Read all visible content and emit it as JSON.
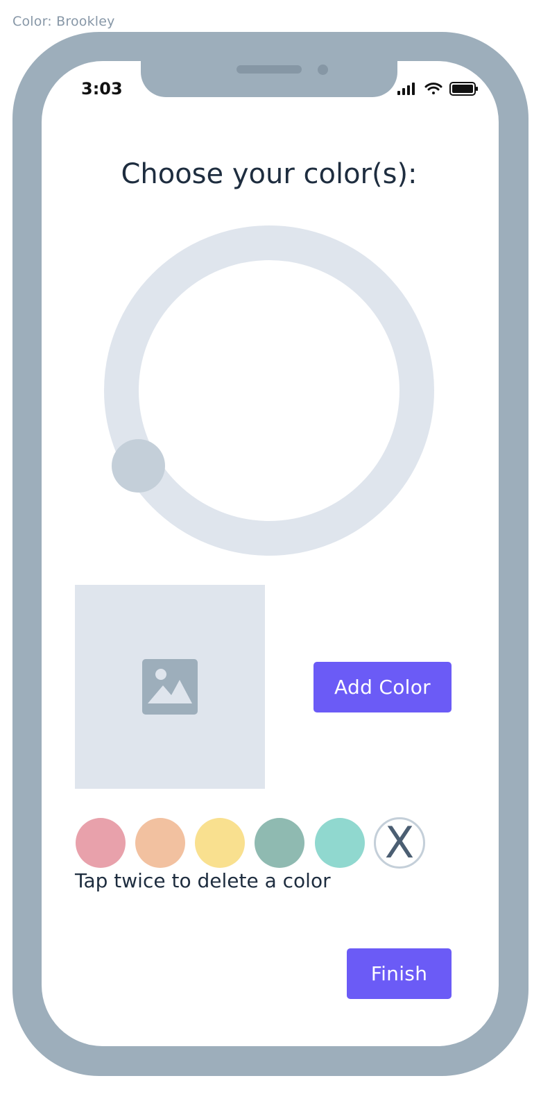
{
  "frame": {
    "label": "Color: Brookley"
  },
  "status_bar": {
    "time": "3:03"
  },
  "main": {
    "title": "Choose your color(s):",
    "add_color_label": "Add Color",
    "hint": "Tap twice to delete a color",
    "finish_label": "Finish",
    "delete_glyph": "X"
  },
  "swatches": [
    {
      "name": "pink",
      "color": "#e8a1ab"
    },
    {
      "name": "peach",
      "color": "#f2c1a0"
    },
    {
      "name": "yellow",
      "color": "#f9e08f"
    },
    {
      "name": "sage",
      "color": "#8fbab1"
    },
    {
      "name": "aqua",
      "color": "#90d8cf"
    }
  ],
  "colors": {
    "accent": "#6b5bf6",
    "device": "#9daebb",
    "ring": "#dfe5ed",
    "knob": "#c4cfd9",
    "text": "#1e2d3f"
  },
  "icons": {
    "signal": "cellular-signal-icon",
    "wifi": "wifi-icon",
    "battery": "battery-icon",
    "image": "image-placeholder-icon",
    "delete": "close-icon"
  }
}
